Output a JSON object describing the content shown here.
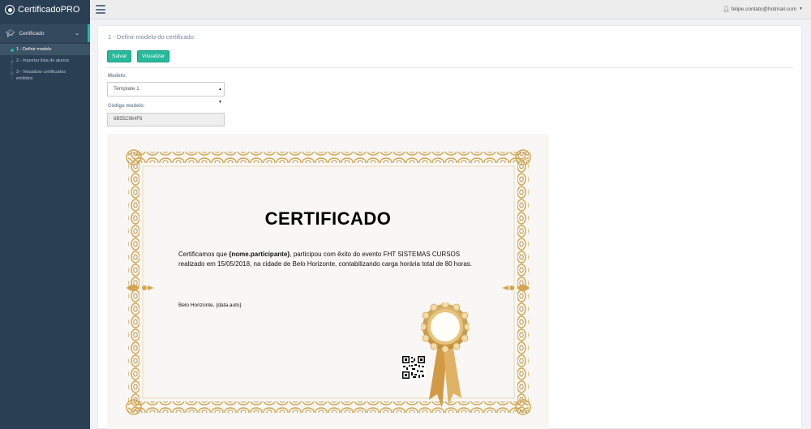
{
  "app": {
    "brand": "CertificadoPRO"
  },
  "sidebar": {
    "section_label": "Certificado",
    "items": [
      {
        "label": "1 - Definir modelo"
      },
      {
        "label": "2 - Importar lista de alunos"
      },
      {
        "label": "3 - Visualizar certificados emitidos"
      }
    ]
  },
  "topbar": {
    "user_email": "felipe.contato@hotmail.com"
  },
  "main": {
    "step_title": "1 - Definir modelo do certificado",
    "save_label": "Salvar",
    "view_label": "Visualizar",
    "model_label": "Modelo:",
    "model_value": "Template 1",
    "code_label": "Código modelo:",
    "code_value": "6B55C964F6"
  },
  "certificate": {
    "title": "CERTIFICADO",
    "body_prefix": "Certificamos que ",
    "participant_placeholder": "{nome.participante}",
    "body_suffix": ", participou com êxito do evento FHT SISTEMAS CURSOS realizado em 15/05/2018, na cidade de Belo Horizonte, contabilizando carga horária total de 80 horas.",
    "city_date": "Belo Horizonte, {data.auto}"
  },
  "icons": {
    "brand": "certificate-logo-icon",
    "menu": "hamburger-icon",
    "section": "graduation-cap-icon",
    "user": "user-icon"
  },
  "colors": {
    "sidebar": "#2a3f54",
    "accent": "#1abb9c",
    "button": "#26b99a",
    "frame_gold": "#d4a64f"
  }
}
